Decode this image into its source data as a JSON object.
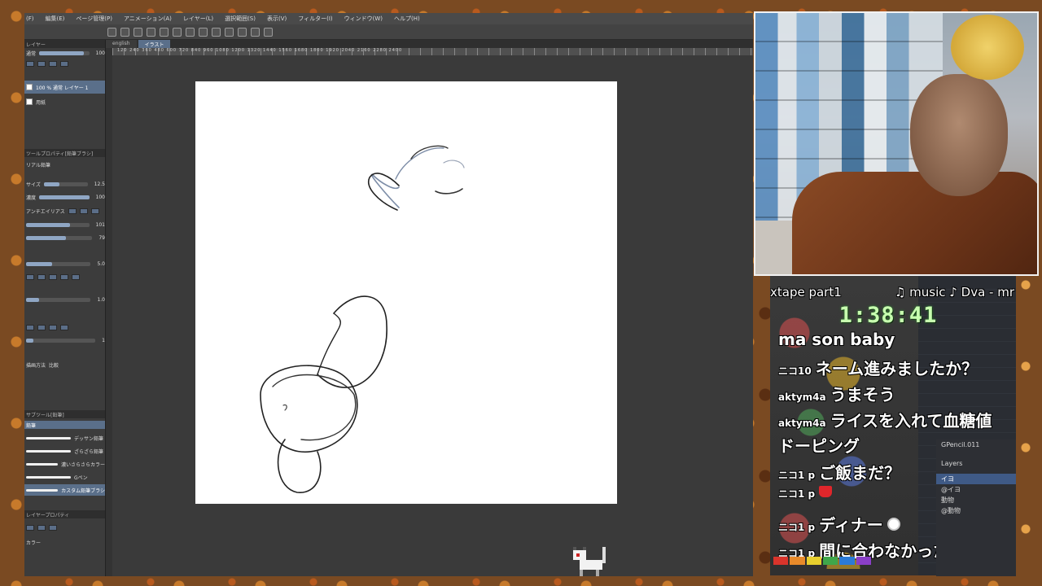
{
  "menu": [
    "(F)",
    "編集(E)",
    "ページ管理(P)",
    "アニメーション(A)",
    "レイヤー(L)",
    "選択範囲(S)",
    "表示(V)",
    "フィルター(I)",
    "ウィンドウ(W)",
    "ヘルプ(H)"
  ],
  "tabs": [
    "english",
    "イラスト"
  ],
  "ruler_text": "120 240 360 480 600 720 840 960 1080 1200 1320 1440 1560 1680 1800 1920 2040 2160 2280 2400",
  "left_panel": {
    "layer_header": "レイヤー",
    "blend_mode": "通常",
    "opacity": "100",
    "layer1": "100 % 通常 レイヤー 1",
    "layer2": "用紙",
    "tool_property_header": "ツールプロパティ[鉛筆ブラシ]",
    "brush_name": "リアル鉛筆",
    "size_label": "サイズ",
    "size_value": "12.5",
    "density_label": "濃度",
    "density_value": "100",
    "antialias_label": "アンチエイリアス",
    "val_101": "101",
    "val_79": "79",
    "val_50": "5.0",
    "val_10": "1.0",
    "val_1": "1",
    "method_label": "描画方法",
    "method_value": "比較",
    "sub_tool_header": "サブツール[鉛筆]",
    "sub_tool_sel": "鉛筆",
    "brush_list": [
      "デッサン鉛筆",
      "ざらざら鉛筆",
      "濃いさらさらカラー",
      "Gペン",
      "カスタム鉛筆ブラシ"
    ],
    "layer_property_header": "レイヤープロパティ",
    "color_label": "カラー"
  },
  "stream": {
    "title": "xtape part1",
    "music": "♫ music ♪ Dva - mr",
    "timer": "1:38:41"
  },
  "chat": [
    {
      "name": "",
      "text": "ma son baby"
    },
    {
      "name": "ニコ10",
      "text": "ネーム進みましたか？"
    },
    {
      "name": "aktym4a",
      "text": "うまそう"
    },
    {
      "name": "aktym4a",
      "text": "ライスを入れて血糖値"
    },
    {
      "name": "",
      "text": "ドーピング"
    },
    {
      "name": "ニコ1 p",
      "text": "ご飯まだ？"
    },
    {
      "name": "ニコ1 p",
      "text": ""
    },
    {
      "name": "ニコ1 p",
      "text": "ディナー"
    },
    {
      "name": "ニコ1 p",
      "text": "間に合わなかった"
    }
  ],
  "gp_panel": {
    "object": "GPencil.011",
    "header": "Layers",
    "rows": [
      "イヨ",
      "@イヨ",
      "動物",
      "@動物"
    ]
  }
}
